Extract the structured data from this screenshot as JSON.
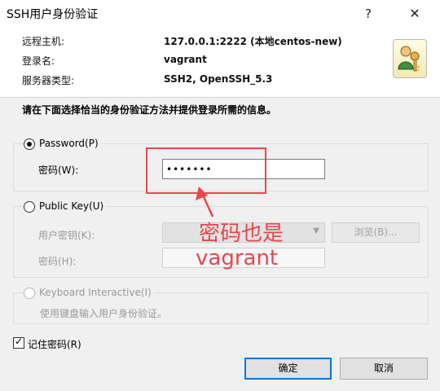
{
  "window": {
    "title": "SSH用户身份验证",
    "help_glyph": "?",
    "close_glyph": "✕"
  },
  "info": {
    "host_label": "远程主机:",
    "host_value": "127.0.0.1:2222 (本地centos-new)",
    "login_label": "登录名:",
    "login_value": "vagrant",
    "server_type_label": "服务器类型:",
    "server_type_value": "SSH2, OpenSSH_5.3",
    "icon": "user-key-icon"
  },
  "instruction": "请在下面选择恰当的身份验证方法并提供登录所需的信息。",
  "password_method": {
    "label": "Password(P)",
    "selected": true,
    "password_label": "密码(W):",
    "password_value": "•••••••"
  },
  "public_key_method": {
    "label": "Public Key(U)",
    "selected": false,
    "user_key_label": "用户密钥(K):",
    "browse_label": "浏览(B)...",
    "passphrase_label": "密码(H):"
  },
  "keyboard_method": {
    "label": "Keyboard Interactive(I)",
    "selected": false,
    "description": "使用键盘输入用户身份验证。"
  },
  "remember_password": {
    "label": "记住密码(R)",
    "checked": true
  },
  "buttons": {
    "ok": "确定",
    "cancel": "取消"
  },
  "annotation": {
    "line1": "密码也是",
    "line2": "vagrant",
    "color": "#e8474c"
  }
}
